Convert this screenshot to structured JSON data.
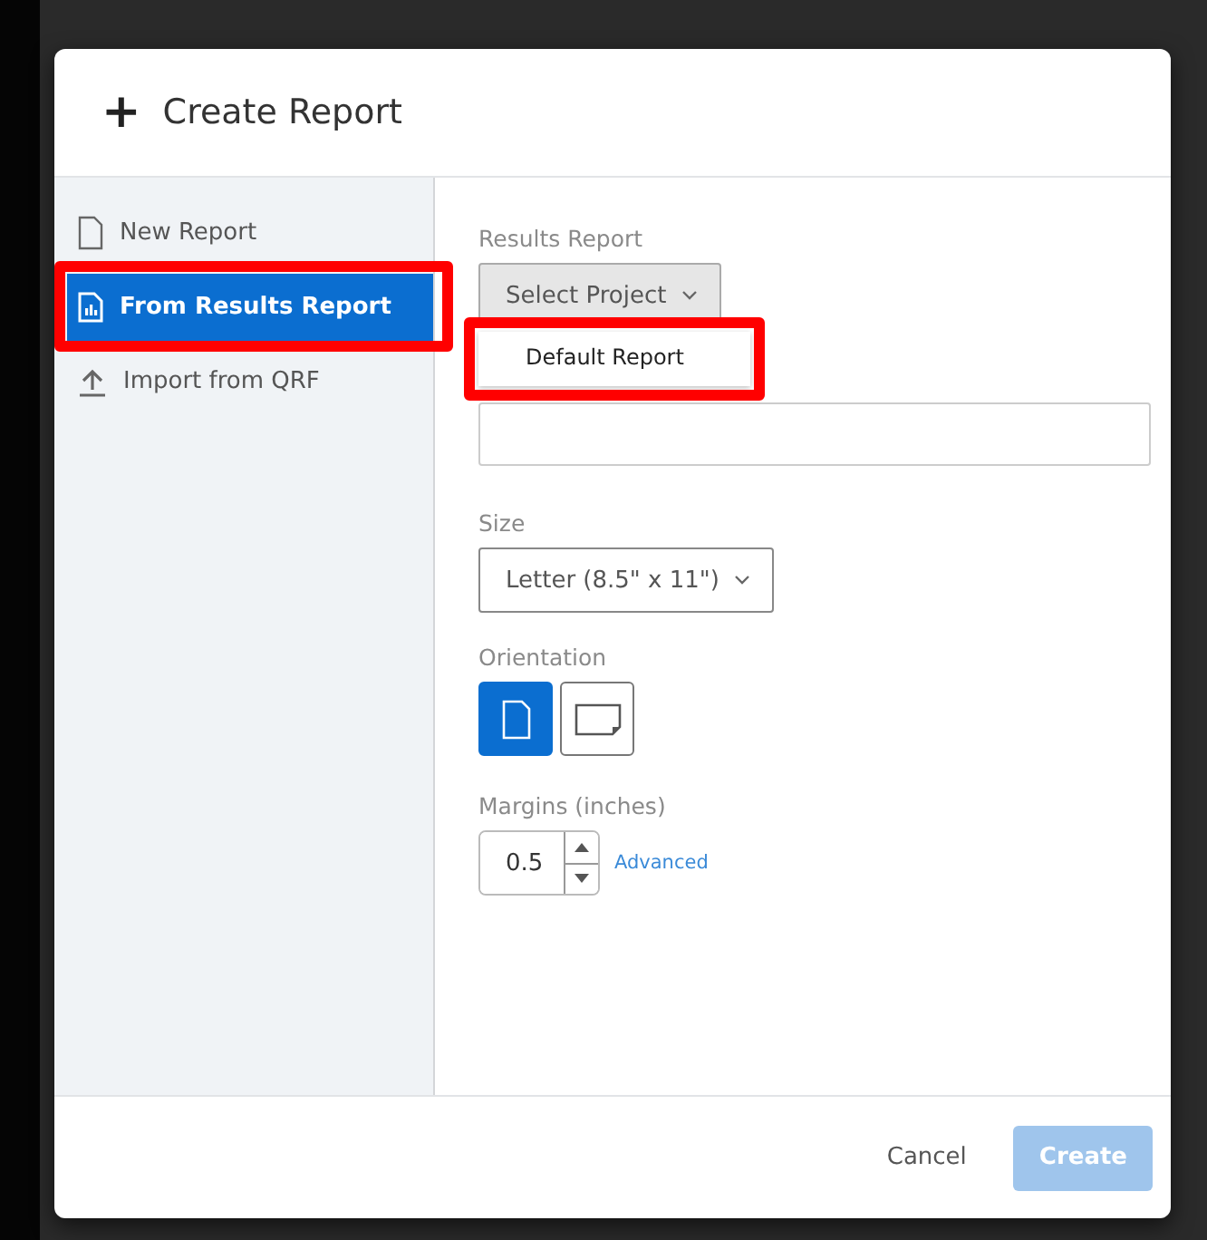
{
  "dialog": {
    "title": "Create Report",
    "title_icon": "+"
  },
  "sidebar": {
    "items": [
      {
        "label": "New Report",
        "kind": "document",
        "selected": false,
        "highlighted": false
      },
      {
        "label": "From Results Report",
        "kind": "chart",
        "selected": true,
        "highlighted": true
      },
      {
        "label": "Import from QRF",
        "kind": "upload",
        "selected": false,
        "highlighted": false
      }
    ]
  },
  "form": {
    "results_report": {
      "label": "Results Report",
      "value": "Select Project",
      "menu": {
        "open": true,
        "highlighted": true,
        "options": [
          "Default Report"
        ]
      }
    },
    "size": {
      "label": "Size",
      "value": "Letter (8.5\" x 11\")"
    },
    "orientation": {
      "label": "Orientation",
      "options": [
        {
          "kind": "portrait",
          "selected": true
        },
        {
          "kind": "landscape",
          "selected": false
        }
      ]
    },
    "margins": {
      "label": "Margins (inches)",
      "value": "0.5",
      "link": "Advanced"
    }
  },
  "footer": {
    "buttons": [
      {
        "label": "Cancel",
        "kind": "secondary",
        "disabled": false
      },
      {
        "label": "Create",
        "kind": "primary",
        "disabled": true
      }
    ]
  }
}
